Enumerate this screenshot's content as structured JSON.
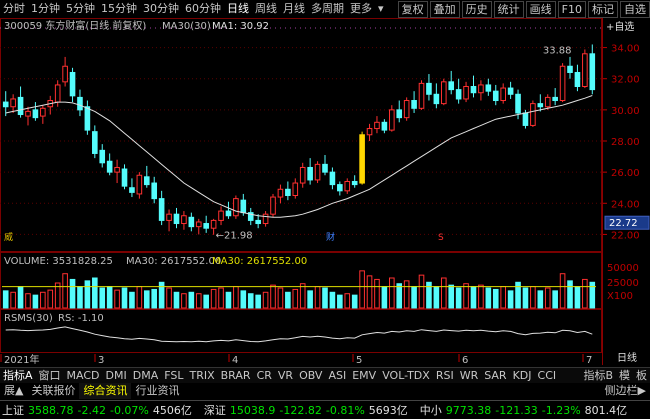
{
  "toolbar": {
    "items": [
      "分时",
      "1分钟",
      "5分钟",
      "15分钟",
      "30分钟",
      "60分钟",
      "日线",
      "周线",
      "月线",
      "多周期",
      "更多"
    ],
    "active": "日线",
    "more_arrow": "▾",
    "buttons": [
      "复权",
      "叠加",
      "历史",
      "统计",
      "画线",
      "F10",
      "标记",
      "自选"
    ]
  },
  "chart_header": {
    "stock": "300059 东方财富(日线 前复权)",
    "ma_name": "MA30(30)",
    "ma_value": "MA1: 30.92"
  },
  "price_axis": [
    "34.00",
    "32.00",
    "30.00",
    "28.00",
    "26.00",
    "24.00",
    "22.00"
  ],
  "current_price_badge": "22.72",
  "annotations": {
    "high": "33.88",
    "low": "21.98",
    "mark_wei": "威",
    "mark_cai": "财",
    "mark_s": "S"
  },
  "volume_header": {
    "label": "VOLUME: 3531828.25",
    "ma30_a": "MA30: 2617552.00",
    "ma30_b": "MA30: 2617552.00"
  },
  "volume_axis": [
    "50000",
    "25000",
    "X100"
  ],
  "rsms_header": {
    "label": "RSMS(30)",
    "rs": "RS: -1.10"
  },
  "date_axis": [
    "2021年",
    "3",
    "4",
    "5",
    "6",
    "7"
  ],
  "right_panel": {
    "add": "+自选",
    "day": "日线"
  },
  "indicator_tabs": [
    "指标A",
    "窗口",
    "MACD",
    "DMI",
    "DMA",
    "FSL",
    "TRIX",
    "BRAR",
    "CR",
    "VR",
    "OBV",
    "ASI",
    "EMV",
    "VOL-TDX",
    "RSI",
    "WR",
    "SAR",
    "KDJ",
    "CCI"
  ],
  "indicator_right": [
    "指标B",
    "模",
    "板"
  ],
  "bottom_tabs": [
    "展▲",
    "关联报价",
    "综合资讯",
    "行业资讯"
  ],
  "bottom_right": "侧边栏▶",
  "ticker": [
    {
      "name": "上证",
      "price": "3588.78",
      "chg": "-2.42",
      "pct": "-0.07%",
      "vol": "4506亿",
      "color": "#00e000"
    },
    {
      "name": "深证",
      "price": "15038.9",
      "chg": "-122.82",
      "pct": "-0.81%",
      "vol": "5693亿",
      "color": "#00e000"
    },
    {
      "name": "中小",
      "price": "9773.38",
      "chg": "-121.33",
      "pct": "-1.23%",
      "vol": "801.4亿",
      "color": "#00e000"
    }
  ],
  "colors": {
    "up": "#ff3030",
    "down": "#54fcfc",
    "ma": "#e0e0e0",
    "grid": "#7a0000",
    "axis": "#c00000",
    "highlight": "#ffd700"
  },
  "chart_data": {
    "type": "candlestick",
    "ylim": [
      21,
      35
    ],
    "candles": [
      {
        "o": 30.5,
        "h": 31.2,
        "l": 29.6,
        "c": 30.2
      },
      {
        "o": 30.2,
        "h": 31.0,
        "l": 29.8,
        "c": 30.7
      },
      {
        "o": 30.8,
        "h": 31.5,
        "l": 29.5,
        "c": 29.7
      },
      {
        "o": 29.6,
        "h": 30.2,
        "l": 29.0,
        "c": 29.9
      },
      {
        "o": 30.0,
        "h": 30.5,
        "l": 29.3,
        "c": 29.5
      },
      {
        "o": 29.6,
        "h": 30.3,
        "l": 29.1,
        "c": 30.1
      },
      {
        "o": 30.2,
        "h": 30.9,
        "l": 29.7,
        "c": 30.6
      },
      {
        "o": 30.5,
        "h": 31.9,
        "l": 30.2,
        "c": 31.6
      },
      {
        "o": 31.8,
        "h": 33.4,
        "l": 31.5,
        "c": 32.8
      },
      {
        "o": 32.4,
        "h": 32.7,
        "l": 30.5,
        "c": 30.9
      },
      {
        "o": 30.8,
        "h": 31.3,
        "l": 29.6,
        "c": 30.0
      },
      {
        "o": 30.2,
        "h": 30.6,
        "l": 28.4,
        "c": 28.7
      },
      {
        "o": 28.6,
        "h": 29.0,
        "l": 26.9,
        "c": 27.2
      },
      {
        "o": 27.4,
        "h": 27.8,
        "l": 26.3,
        "c": 26.6
      },
      {
        "o": 26.7,
        "h": 27.2,
        "l": 25.8,
        "c": 26.0
      },
      {
        "o": 26.0,
        "h": 26.8,
        "l": 25.3,
        "c": 26.3
      },
      {
        "o": 26.2,
        "h": 26.5,
        "l": 24.9,
        "c": 25.1
      },
      {
        "o": 25.0,
        "h": 25.6,
        "l": 24.4,
        "c": 24.7
      },
      {
        "o": 24.6,
        "h": 26.0,
        "l": 24.3,
        "c": 25.8
      },
      {
        "o": 25.7,
        "h": 26.4,
        "l": 25.0,
        "c": 25.2
      },
      {
        "o": 25.3,
        "h": 25.7,
        "l": 24.0,
        "c": 24.3
      },
      {
        "o": 24.3,
        "h": 24.8,
        "l": 22.6,
        "c": 22.9
      },
      {
        "o": 22.9,
        "h": 23.6,
        "l": 22.2,
        "c": 23.3
      },
      {
        "o": 23.3,
        "h": 23.7,
        "l": 22.4,
        "c": 22.7
      },
      {
        "o": 22.7,
        "h": 23.5,
        "l": 22.3,
        "c": 23.2
      },
      {
        "o": 23.1,
        "h": 23.4,
        "l": 22.2,
        "c": 22.5
      },
      {
        "o": 22.5,
        "h": 23.0,
        "l": 22.0,
        "c": 22.8
      },
      {
        "o": 22.7,
        "h": 23.2,
        "l": 22.1,
        "c": 22.4
      },
      {
        "o": 22.4,
        "h": 23.0,
        "l": 21.98,
        "c": 22.9
      },
      {
        "o": 22.9,
        "h": 23.8,
        "l": 22.6,
        "c": 23.5
      },
      {
        "o": 23.5,
        "h": 24.1,
        "l": 23.0,
        "c": 23.2
      },
      {
        "o": 23.2,
        "h": 24.5,
        "l": 23.0,
        "c": 24.3
      },
      {
        "o": 24.2,
        "h": 24.6,
        "l": 23.2,
        "c": 23.4
      },
      {
        "o": 23.4,
        "h": 23.7,
        "l": 22.6,
        "c": 22.9
      },
      {
        "o": 22.9,
        "h": 23.3,
        "l": 22.4,
        "c": 22.7
      },
      {
        "o": 22.7,
        "h": 23.5,
        "l": 22.5,
        "c": 23.3
      },
      {
        "o": 23.3,
        "h": 24.6,
        "l": 23.1,
        "c": 24.4
      },
      {
        "o": 24.4,
        "h": 25.2,
        "l": 24.0,
        "c": 24.9
      },
      {
        "o": 24.9,
        "h": 25.4,
        "l": 24.2,
        "c": 24.5
      },
      {
        "o": 24.5,
        "h": 25.6,
        "l": 24.3,
        "c": 25.3
      },
      {
        "o": 25.3,
        "h": 26.6,
        "l": 25.0,
        "c": 26.3
      },
      {
        "o": 26.3,
        "h": 26.9,
        "l": 25.2,
        "c": 25.5
      },
      {
        "o": 25.5,
        "h": 26.7,
        "l": 25.3,
        "c": 26.5
      },
      {
        "o": 26.5,
        "h": 27.1,
        "l": 25.8,
        "c": 26.0
      },
      {
        "o": 26.0,
        "h": 26.3,
        "l": 24.9,
        "c": 25.2
      },
      {
        "o": 25.2,
        "h": 25.4,
        "l": 24.5,
        "c": 24.8
      },
      {
        "o": 24.8,
        "h": 25.6,
        "l": 24.6,
        "c": 25.4
      },
      {
        "o": 25.4,
        "h": 25.8,
        "l": 25.0,
        "c": 25.2
      },
      {
        "o": 25.3,
        "h": 28.6,
        "l": 25.2,
        "c": 28.4
      },
      {
        "o": 28.4,
        "h": 29.1,
        "l": 28.0,
        "c": 28.8
      },
      {
        "o": 28.8,
        "h": 29.6,
        "l": 28.5,
        "c": 29.2
      },
      {
        "o": 29.2,
        "h": 29.4,
        "l": 28.5,
        "c": 28.7
      },
      {
        "o": 28.7,
        "h": 30.3,
        "l": 28.6,
        "c": 30.0
      },
      {
        "o": 30.0,
        "h": 30.6,
        "l": 29.2,
        "c": 29.5
      },
      {
        "o": 29.5,
        "h": 30.8,
        "l": 29.3,
        "c": 30.6
      },
      {
        "o": 30.6,
        "h": 31.2,
        "l": 29.8,
        "c": 30.1
      },
      {
        "o": 30.1,
        "h": 31.9,
        "l": 30.0,
        "c": 31.7
      },
      {
        "o": 31.7,
        "h": 32.3,
        "l": 30.6,
        "c": 31.0
      },
      {
        "o": 31.0,
        "h": 31.7,
        "l": 30.1,
        "c": 30.4
      },
      {
        "o": 30.4,
        "h": 32.0,
        "l": 30.3,
        "c": 31.8
      },
      {
        "o": 31.8,
        "h": 32.5,
        "l": 31.0,
        "c": 31.3
      },
      {
        "o": 31.3,
        "h": 32.0,
        "l": 30.4,
        "c": 30.7
      },
      {
        "o": 30.7,
        "h": 31.8,
        "l": 30.5,
        "c": 31.5
      },
      {
        "o": 31.5,
        "h": 32.2,
        "l": 30.8,
        "c": 31.1
      },
      {
        "o": 31.1,
        "h": 31.9,
        "l": 30.6,
        "c": 31.6
      },
      {
        "o": 31.6,
        "h": 32.0,
        "l": 30.9,
        "c": 31.2
      },
      {
        "o": 31.2,
        "h": 31.6,
        "l": 30.3,
        "c": 30.6
      },
      {
        "o": 30.6,
        "h": 31.7,
        "l": 30.4,
        "c": 31.4
      },
      {
        "o": 31.4,
        "h": 31.8,
        "l": 30.7,
        "c": 31.0
      },
      {
        "o": 31.0,
        "h": 31.3,
        "l": 29.4,
        "c": 29.8
      },
      {
        "o": 29.8,
        "h": 30.0,
        "l": 28.8,
        "c": 29.0
      },
      {
        "o": 29.0,
        "h": 30.6,
        "l": 28.9,
        "c": 30.4
      },
      {
        "o": 30.4,
        "h": 31.0,
        "l": 29.9,
        "c": 30.2
      },
      {
        "o": 30.2,
        "h": 31.0,
        "l": 30.0,
        "c": 30.8
      },
      {
        "o": 30.8,
        "h": 31.4,
        "l": 30.3,
        "c": 30.6
      },
      {
        "o": 30.6,
        "h": 33.0,
        "l": 30.5,
        "c": 32.8
      },
      {
        "o": 32.8,
        "h": 33.4,
        "l": 32.0,
        "c": 32.4
      },
      {
        "o": 32.4,
        "h": 32.9,
        "l": 31.2,
        "c": 31.5
      },
      {
        "o": 31.5,
        "h": 33.88,
        "l": 31.4,
        "c": 33.6
      },
      {
        "o": 33.6,
        "h": 34.2,
        "l": 31.0,
        "c": 31.3
      }
    ],
    "ma30": [
      29.8,
      29.9,
      30.0,
      30.1,
      30.2,
      30.3,
      30.4,
      30.5,
      30.5,
      30.45,
      30.3,
      30.1,
      29.9,
      29.6,
      29.3,
      28.9,
      28.5,
      28.1,
      27.7,
      27.3,
      26.9,
      26.5,
      26.1,
      25.7,
      25.3,
      25.0,
      24.7,
      24.4,
      24.1,
      23.9,
      23.7,
      23.5,
      23.4,
      23.3,
      23.2,
      23.15,
      23.1,
      23.1,
      23.15,
      23.2,
      23.3,
      23.45,
      23.6,
      23.8,
      24.0,
      24.15,
      24.3,
      24.5,
      24.7,
      24.9,
      25.2,
      25.5,
      25.8,
      26.1,
      26.4,
      26.7,
      27.0,
      27.3,
      27.6,
      27.9,
      28.2,
      28.4,
      28.6,
      28.8,
      29.0,
      29.2,
      29.4,
      29.5,
      29.6,
      29.7,
      29.8,
      29.9,
      30.0,
      30.1,
      30.2,
      30.3,
      30.45,
      30.6,
      30.75,
      30.92
    ],
    "volume": [
      24,
      22,
      30,
      20,
      18,
      22,
      25,
      35,
      48,
      40,
      30,
      38,
      42,
      28,
      30,
      25,
      28,
      22,
      30,
      24,
      26,
      36,
      28,
      22,
      20,
      22,
      20,
      18,
      26,
      28,
      22,
      30,
      24,
      20,
      18,
      22,
      32,
      28,
      22,
      26,
      34,
      24,
      30,
      28,
      22,
      18,
      20,
      18,
      52,
      45,
      40,
      30,
      42,
      34,
      38,
      30,
      46,
      36,
      30,
      42,
      32,
      28,
      34,
      30,
      32,
      28,
      26,
      30,
      24,
      36,
      28,
      30,
      24,
      28,
      24,
      48,
      38,
      30,
      40,
      36
    ],
    "rsms": [
      0.75,
      0.76,
      0.74,
      0.73,
      0.74,
      0.75,
      0.77,
      0.82,
      0.86,
      0.8,
      0.74,
      0.68,
      0.6,
      0.55,
      0.5,
      0.47,
      0.44,
      0.42,
      0.45,
      0.43,
      0.4,
      0.35,
      0.34,
      0.33,
      0.34,
      0.33,
      0.35,
      0.33,
      0.36,
      0.38,
      0.36,
      0.4,
      0.37,
      0.34,
      0.33,
      0.36,
      0.4,
      0.44,
      0.43,
      0.47,
      0.52,
      0.5,
      0.53,
      0.5,
      0.46,
      0.44,
      0.47,
      0.46,
      0.58,
      0.62,
      0.66,
      0.64,
      0.7,
      0.68,
      0.72,
      0.7,
      0.76,
      0.73,
      0.7,
      0.75,
      0.73,
      0.71,
      0.74,
      0.72,
      0.74,
      0.71,
      0.69,
      0.72,
      0.7,
      0.62,
      0.58,
      0.63,
      0.64,
      0.67,
      0.65,
      0.74,
      0.72,
      0.66,
      0.7,
      0.6
    ]
  }
}
